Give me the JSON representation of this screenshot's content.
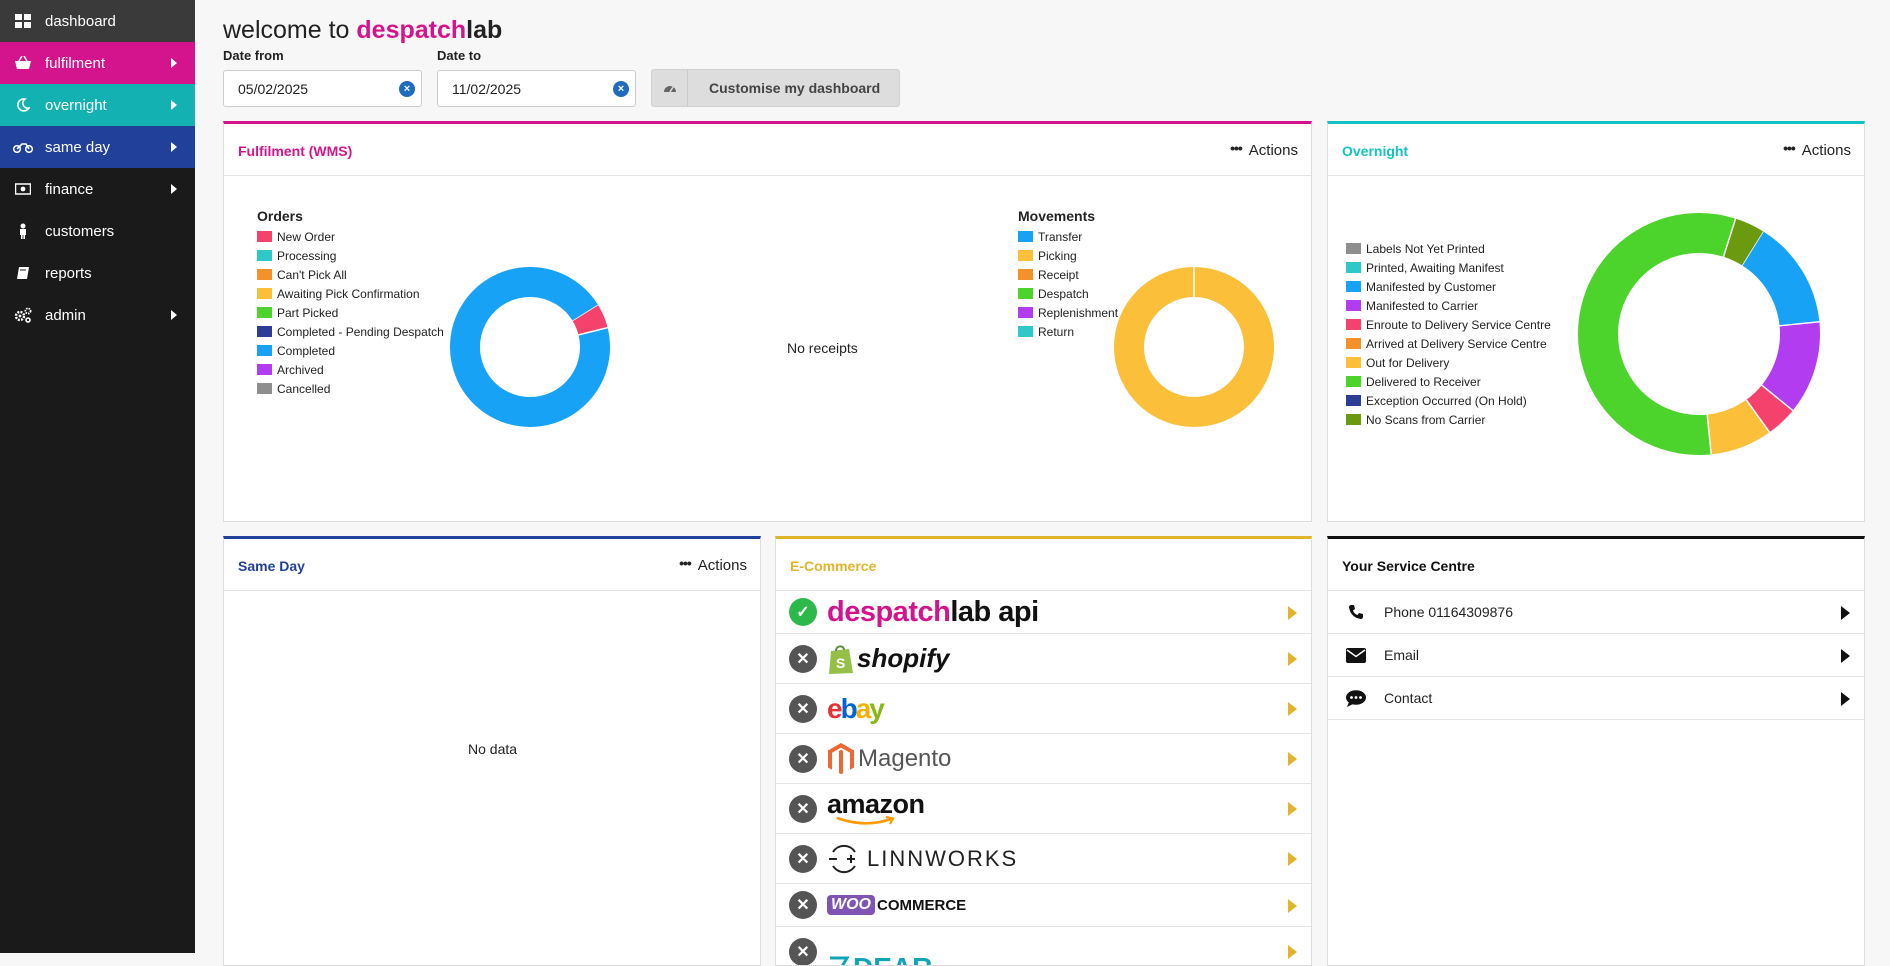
{
  "sidebar": {
    "items": [
      {
        "label": "dashboard",
        "icon": "dashboard-icon",
        "bg": "#3a3a3a",
        "arrow": false
      },
      {
        "label": "fulfilment",
        "icon": "basket-icon",
        "bg": "#d4148c",
        "arrow": true
      },
      {
        "label": "overnight",
        "icon": "moon-icon",
        "bg": "#13b1b1",
        "arrow": true
      },
      {
        "label": "same day",
        "icon": "motorbike-icon",
        "bg": "#21409a",
        "arrow": true
      },
      {
        "label": "finance",
        "icon": "money-icon",
        "bg": "#1a1a1a",
        "arrow": true
      },
      {
        "label": "customers",
        "icon": "person-icon",
        "bg": "#1a1a1a",
        "arrow": false
      },
      {
        "label": "reports",
        "icon": "book-icon",
        "bg": "#1a1a1a",
        "arrow": false
      },
      {
        "label": "admin",
        "icon": "cogs-icon",
        "bg": "#1a1a1a",
        "arrow": true
      }
    ]
  },
  "header": {
    "welcome": "welcome to",
    "brand_part1": "despatch",
    "brand_part2": "lab",
    "date_from_label": "Date from",
    "date_from_value": "05/02/2025",
    "date_to_label": "Date to",
    "date_to_value": "11/02/2025",
    "clear_glyph": "×",
    "customise_label": "Customise my dashboard"
  },
  "colors": {
    "fulfilment": "#d4148c",
    "overnight": "#13c3c3",
    "sameday": "#21409a",
    "ecommerce": "#e0b52a",
    "service": "#111111"
  },
  "fulfilment": {
    "title": "Fulfilment (WMS)",
    "actions_label": "Actions",
    "orders_title": "Orders",
    "orders_legend": [
      {
        "label": "New Order",
        "color": "#f5426c"
      },
      {
        "label": "Processing",
        "color": "#2ec8c8"
      },
      {
        "label": "Can't Pick All",
        "color": "#f5912a"
      },
      {
        "label": "Awaiting Pick Confirmation",
        "color": "#fbbf3a"
      },
      {
        "label": "Part Picked",
        "color": "#4cd32c"
      },
      {
        "label": "Completed - Pending Despatch",
        "color": "#2b3d94"
      },
      {
        "label": "Completed",
        "color": "#17a2f5"
      },
      {
        "label": "Archived",
        "color": "#b13cf0"
      },
      {
        "label": "Cancelled",
        "color": "#8e8e8e"
      }
    ],
    "no_receipts": "No receipts",
    "movements_title": "Movements",
    "movements_legend": [
      {
        "label": "Transfer",
        "color": "#17a2f5"
      },
      {
        "label": "Picking",
        "color": "#fbbf3a"
      },
      {
        "label": "Receipt",
        "color": "#f5912a"
      },
      {
        "label": "Despatch",
        "color": "#4cd32c"
      },
      {
        "label": "Replenishment",
        "color": "#b13cf0"
      },
      {
        "label": "Return",
        "color": "#2ec8c8"
      }
    ]
  },
  "overnight": {
    "title": "Overnight",
    "actions_label": "Actions",
    "legend": [
      {
        "label": "Labels Not Yet Printed",
        "color": "#8e8e8e"
      },
      {
        "label": "Printed, Awaiting Manifest",
        "color": "#2ec8c8"
      },
      {
        "label": "Manifested by Customer",
        "color": "#17a2f5"
      },
      {
        "label": "Manifested to Carrier",
        "color": "#b13cf0"
      },
      {
        "label": "Enroute to Delivery Service Centre",
        "color": "#f5426c"
      },
      {
        "label": "Arrived at Delivery Service Centre",
        "color": "#f5912a"
      },
      {
        "label": "Out for Delivery",
        "color": "#fbbf3a"
      },
      {
        "label": "Delivered to Receiver",
        "color": "#4cd32c"
      },
      {
        "label": "Exception Occurred (On Hold)",
        "color": "#2b3d94"
      },
      {
        "label": "No Scans from Carrier",
        "color": "#6b9a10"
      }
    ]
  },
  "sameday": {
    "title": "Same Day",
    "actions_label": "Actions",
    "no_data": "No data"
  },
  "ecommerce": {
    "title": "E-Commerce",
    "items": [
      {
        "name": "despatchlab api",
        "part1": "despatch",
        "part2": "lab api",
        "status": "connected"
      },
      {
        "name": "shopify",
        "status": "disconnected"
      },
      {
        "name": "ebay",
        "e": "e",
        "b": "b",
        "a": "a",
        "y": "y",
        "status": "disconnected"
      },
      {
        "name": "Magento",
        "status": "disconnected"
      },
      {
        "name": "amazon",
        "status": "disconnected"
      },
      {
        "name": "LINNWORKS",
        "status": "disconnected"
      },
      {
        "name": "WOOCOMMERCE",
        "woo": "WOO",
        "commerce": "COMMERCE",
        "status": "disconnected"
      },
      {
        "name": "DEAR",
        "status": "disconnected"
      }
    ]
  },
  "service": {
    "title": "Your Service Centre",
    "items": [
      {
        "label": "Phone 01164309876",
        "icon": "phone-icon"
      },
      {
        "label": "Email",
        "icon": "envelope-icon"
      },
      {
        "label": "Contact",
        "icon": "chat-icon"
      }
    ]
  },
  "chart_data": [
    {
      "type": "pie",
      "title": "Orders",
      "categories": [
        "New Order",
        "Processing",
        "Can't Pick All",
        "Awaiting Pick Confirmation",
        "Part Picked",
        "Completed - Pending Despatch",
        "Completed",
        "Archived",
        "Cancelled"
      ],
      "values": [
        5,
        0,
        0,
        0,
        0,
        0,
        95,
        0,
        0
      ]
    },
    {
      "type": "pie",
      "title": "Movements",
      "categories": [
        "Transfer",
        "Picking",
        "Receipt",
        "Despatch",
        "Replenishment",
        "Return"
      ],
      "values": [
        0,
        100,
        0,
        0,
        0,
        0
      ]
    },
    {
      "type": "pie",
      "title": "",
      "categories": [
        "Labels Not Yet Printed",
        "Printed, Awaiting Manifest",
        "Manifested by Customer",
        "Manifested to Carrier",
        "Enroute to Delivery Service Centre",
        "Arrived at Delivery Service Centre",
        "Out for Delivery",
        "Delivered to Receiver",
        "Exception Occurred (On Hold)",
        "No Scans from Carrier"
      ],
      "values": [
        0,
        0,
        14.5,
        12.5,
        4.2,
        0,
        8.3,
        56.5,
        0,
        4
      ]
    }
  ]
}
